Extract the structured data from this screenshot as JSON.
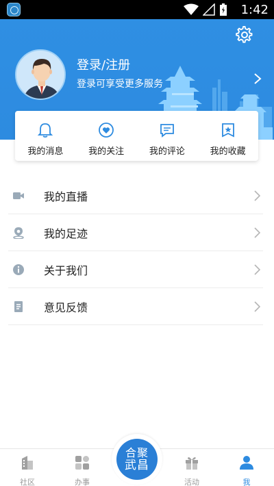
{
  "status_bar": {
    "time": "1:42"
  },
  "header": {
    "login_title": "登录/注册",
    "login_subtitle": "登录可享受更多服务"
  },
  "quick_actions": [
    {
      "label": "我的消息",
      "icon": "bell-icon"
    },
    {
      "label": "我的关注",
      "icon": "heart-icon"
    },
    {
      "label": "我的评论",
      "icon": "comment-icon"
    },
    {
      "label": "我的收藏",
      "icon": "bookmark-icon"
    }
  ],
  "menu": [
    {
      "label": "我的直播",
      "icon": "video-icon"
    },
    {
      "label": "我的足迹",
      "icon": "location-pin-icon"
    },
    {
      "label": "关于我们",
      "icon": "info-icon"
    },
    {
      "label": "意见反馈",
      "icon": "feedback-icon"
    }
  ],
  "bottom_nav": {
    "items": [
      {
        "label": "社区",
        "icon": "building-icon"
      },
      {
        "label": "办事",
        "icon": "grid-icon"
      },
      {
        "label": "活动",
        "icon": "gift-icon"
      },
      {
        "label": "我",
        "icon": "person-icon",
        "active": true
      }
    ],
    "center_logo": {
      "line1": "合聚",
      "line2": "武昌"
    }
  },
  "colors": {
    "primary": "#2d8be0",
    "nav_inactive": "#9a9a9a",
    "icon_gray": "#9aaab8"
  }
}
